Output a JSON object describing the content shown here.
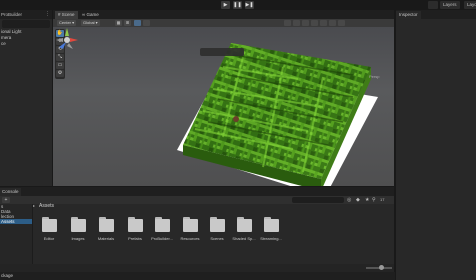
{
  "topbar": {
    "play_glyph": "▶",
    "pause_glyph": "❚❚",
    "step_glyph": "▶❚",
    "layers_label": "Layers",
    "layout_label": "Layo"
  },
  "hierarchy": {
    "tab_label": "ProBuilder",
    "menu_glyph": "⋮",
    "items": [
      "ional Light",
      "mera",
      "ce"
    ]
  },
  "scene": {
    "tabs": [
      {
        "label": "# Scene",
        "active": true
      },
      {
        "label": "∞ Game",
        "active": false
      }
    ],
    "pivot_dropdown": "Center ▾",
    "space_dropdown": "Global ▾",
    "grid_btn": "▦",
    "snap_btn": "⊞",
    "persp_label": "Persp",
    "orientation_axes": [
      "y",
      "x",
      "z"
    ],
    "tools": [
      "✋",
      "✥",
      "⟲",
      "⤡",
      "▭",
      "⚙"
    ],
    "overlay_buttons": [
      "⬚",
      "⬚",
      "◐",
      "◉"
    ]
  },
  "inspector": {
    "tab_label": "Inspector"
  },
  "bottom": {
    "tab_label": "Console",
    "add_glyph": "+",
    "hidden_count": "17",
    "breadcrumb": "Assets",
    "tree_items": [
      {
        "label": "s",
        "selected": false
      },
      {
        "label": "",
        "selected": false
      },
      {
        "label": "",
        "selected": false
      },
      {
        "label": "Data",
        "selected": false
      },
      {
        "label": "",
        "selected": false
      },
      {
        "label": "lection",
        "selected": false
      },
      {
        "label": "Assets",
        "selected": true
      },
      {
        "label": "",
        "selected": false
      },
      {
        "label": "",
        "selected": false
      },
      {
        "label": "ckage",
        "selected": false
      }
    ],
    "folders": [
      "Editor",
      "Images",
      "Materials",
      "Prefabs",
      "ProBuilder...",
      "Resources",
      "Scenes",
      "Shaded Sp...",
      "Streaming..."
    ],
    "slider_value": 0.6
  },
  "status": {
    "text": "ckage"
  }
}
